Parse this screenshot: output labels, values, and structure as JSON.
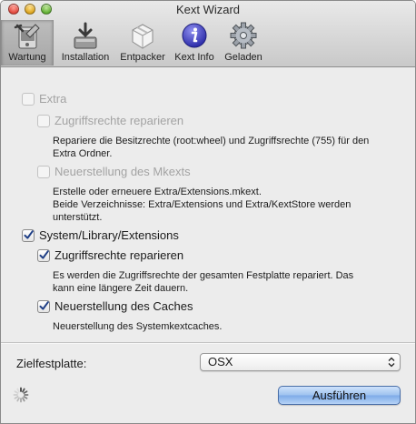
{
  "window": {
    "title": "Kext Wizard"
  },
  "toolbar": {
    "tabs": [
      {
        "label": "Wartung",
        "icon": "maintenance-icon",
        "active": true
      },
      {
        "label": "Installation",
        "icon": "installer-icon",
        "active": false
      },
      {
        "label": "Entpacker",
        "icon": "package-icon",
        "active": false
      },
      {
        "label": "Kext Info",
        "icon": "info-icon",
        "active": false
      },
      {
        "label": "Geladen",
        "icon": "gear-icon",
        "active": false
      }
    ]
  },
  "extra": {
    "label": "Extra",
    "checked": false,
    "enabled": false,
    "permissions": {
      "label": "Zugriffsrechte reparieren",
      "checked": false,
      "enabled": false,
      "desc_1": "Repariere die Besitzrechte (root:wheel) und Zugriffsrechte (755) für den",
      "desc_2": "Extra Ordner."
    },
    "mkext": {
      "label": "Neuerstellung des Mkexts",
      "checked": false,
      "enabled": false,
      "desc_1": "Erstelle oder erneuere Extra/Extensions.mkext.",
      "desc_2": "Beide Verzeichnisse: Extra/Extensions und Extra/KextStore werden",
      "desc_3": "unterstützt."
    }
  },
  "system": {
    "label": "System/Library/Extensions",
    "checked": true,
    "permissions": {
      "label": "Zugriffsrechte reparieren",
      "checked": true,
      "desc_1": "Es werden die Zugriffsrechte der gesamten Festplatte repariert. Das",
      "desc_2": "kann eine längere Zeit dauern."
    },
    "caches": {
      "label": "Neuerstellung des Caches",
      "checked": true,
      "desc_1": "Neuerstellung des Systemkextcaches."
    }
  },
  "target": {
    "label": "Zielfestplatte:",
    "selected": "OSX"
  },
  "actions": {
    "run_label": "Ausführen"
  },
  "colors": {
    "accent": "#7eabe8",
    "checkmark": "#1f3f86"
  }
}
